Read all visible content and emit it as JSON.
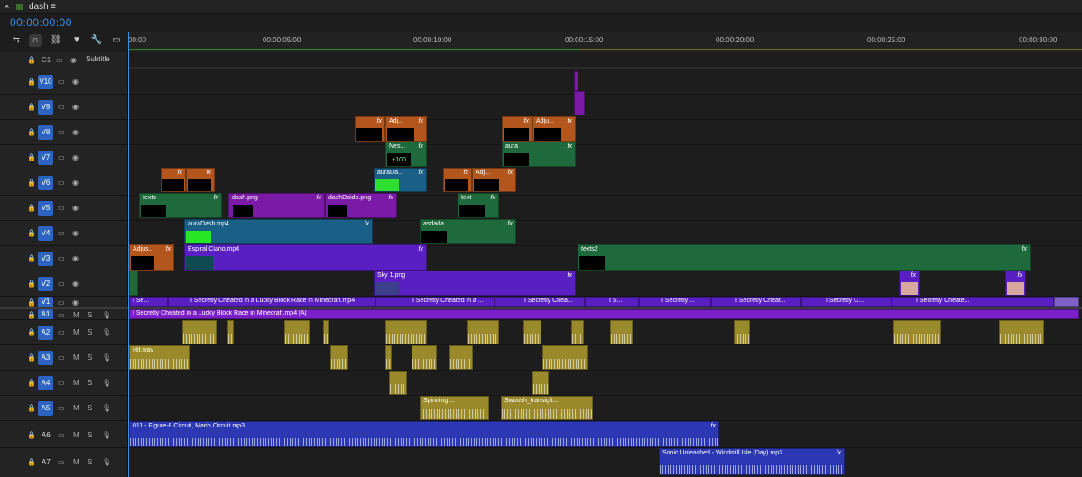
{
  "window": {
    "tab_title": "dash",
    "menu_icon": "hamburger-menu-icon",
    "close_icon": "close-icon"
  },
  "timecode": "00:00:00:00",
  "toolbar": {
    "icons": [
      "insert-sequence-icon",
      "snap-magnet-icon",
      "linked-selection-icon",
      "add-marker-icon",
      "settings-wrench-icon",
      "captions-icon"
    ]
  },
  "ruler": {
    "ticks": [
      "00:00",
      "00:00:05:00",
      "00:00:10:00",
      "00:00:15:00",
      "00:00:20:00",
      "00:00:25:00",
      "00:00:30:00"
    ]
  },
  "tracks": {
    "caption": {
      "name": "C1",
      "label": "Subtitle"
    },
    "video": [
      "V10",
      "V9",
      "V8",
      "V7",
      "V6",
      "V5",
      "V4",
      "V3",
      "V2",
      "V1"
    ],
    "audio": [
      "A1",
      "A2",
      "A3",
      "A4",
      "A5",
      "A6",
      "A7"
    ],
    "audio_buttons": {
      "mute": "M",
      "solo": "S"
    }
  },
  "clips": {
    "v8": {
      "adj1": "Adj...",
      "adj2": "Adju...",
      "fx": "fx"
    },
    "v7": {
      "nes": "Nes...",
      "nes_badge": "+100",
      "aura": "aura"
    },
    "v6": {
      "auradash": "auraDa...",
      "adj": "Adj..."
    },
    "v5": {
      "texts": "texts",
      "dashpng": "dash.png",
      "dashdoido": "dashDoido.png",
      "text": "text"
    },
    "v4": {
      "auradash": "auraDash.mp4",
      "asdada": "asdada"
    },
    "v3": {
      "adjus": "Adjus...",
      "espiral": "Espiral Ciano.mp4",
      "texts2": "texts2"
    },
    "v2": {
      "sky": "Sky 1.png"
    },
    "v1": {
      "c1": "I Se...",
      "c2": "I Secretly Cheated in a Lucky Block Race in Minecraft.mp4",
      "c3": "I Secretly Cheated in a ...",
      "c4": "I Secretly Chea...",
      "c5": "I S...",
      "c6": "I Secretly ...",
      "c7": "I Secretly Cheat...",
      "c8": "I Secretly C...",
      "c9": "I Secretly Cheate..."
    },
    "a1": {
      "main": "I Secretly Cheated in a Lucky Block Race in Minecraft.mp4 [A]"
    },
    "a3": {
      "hit": "Hit.wav"
    },
    "a5": {
      "spinning": "Spinning ...",
      "swoosh": "Swoosh_transiçã..."
    },
    "a6": {
      "circuit": "011 - Figure-8 Circuit, Mario Circuit.mp3"
    },
    "a7": {
      "sonic": "Sonic Unleashed - Windmill Isle (Day).mp3"
    }
  },
  "colors": {
    "accent": "#2f8fef",
    "video_label": "#2f63c0",
    "a1_clip": "#7b1fc9",
    "music_clip": "#2b37b3",
    "sfx_clip": "#9a8a2c"
  }
}
